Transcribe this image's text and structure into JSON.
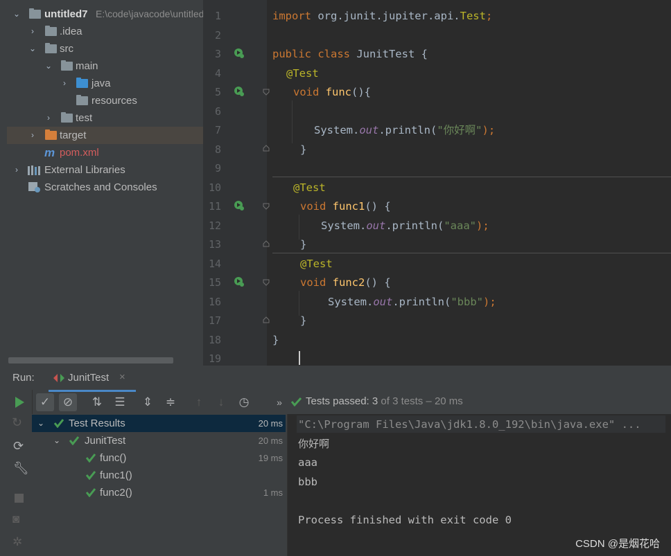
{
  "project_tree": {
    "items": [
      {
        "label": "untitled7",
        "path": "E:\\code\\javacode\\untitled7"
      },
      {
        "label": ".idea"
      },
      {
        "label": "src"
      },
      {
        "label": "main"
      },
      {
        "label": "java"
      },
      {
        "label": "resources"
      },
      {
        "label": "test"
      },
      {
        "label": "target"
      },
      {
        "label": "pom.xml"
      },
      {
        "label": "External Libraries"
      },
      {
        "label": "Scratches and Consoles"
      }
    ]
  },
  "editor": {
    "line_numbers": [
      "1",
      "2",
      "3",
      "4",
      "5",
      "6",
      "7",
      "8",
      "9",
      "10",
      "11",
      "12",
      "13",
      "14",
      "15",
      "16",
      "17",
      "18",
      "19"
    ],
    "lines": {
      "l1_kw": "import",
      "l1_rest": " org.junit.jupiter.api.",
      "l1_test": "Test",
      "l1_end": ";",
      "l3_kw": "public class",
      "l3_rest": " JunitTest {",
      "ann": "@Test",
      "void": "void",
      "func": "func",
      "func1": "func1",
      "func2": "func2",
      "paren_brace_1": "(){",
      "paren_brace_2": "() {",
      "system": "System.",
      "out": "out",
      "println": ".println(",
      "str_nihao": "\"你好啊\"",
      "str_aaa": "\"aaa\"",
      "str_bbb": "\"bbb\"",
      "close_stmt": ");",
      "close_brace": "}"
    }
  },
  "run_panel": {
    "title": "Run:",
    "tab_label": "JunitTest",
    "tab_close": "×",
    "status": {
      "prefix": "Tests passed: ",
      "count": "3",
      "suffix": " of 3 tests – 20 ms"
    },
    "results": [
      {
        "label": "Test Results",
        "time": "20 ms"
      },
      {
        "label": "JunitTest",
        "time": "20 ms"
      },
      {
        "label": "func()",
        "time": "19 ms"
      },
      {
        "label": "func1()",
        "time": ""
      },
      {
        "label": "func2()",
        "time": "1 ms"
      }
    ],
    "console": [
      "\"C:\\Program Files\\Java\\jdk1.8.0_192\\bin\\java.exe\" ...",
      "你好啊",
      "aaa",
      "bbb",
      "",
      "Process finished with exit code 0"
    ]
  },
  "watermark": "CSDN @是烟花哈"
}
